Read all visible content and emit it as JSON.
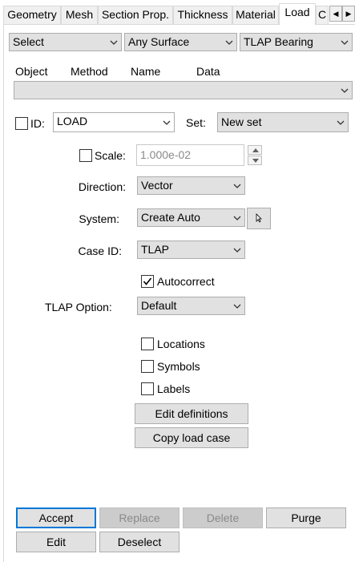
{
  "tabs": [
    {
      "label": "Geometry",
      "active": false
    },
    {
      "label": "Mesh",
      "active": false
    },
    {
      "label": "Section Prop.",
      "active": false
    },
    {
      "label": "Thickness",
      "active": false
    },
    {
      "label": "Material",
      "active": false
    },
    {
      "label": "Load",
      "active": true
    },
    {
      "label": "C",
      "active": false
    }
  ],
  "tab_scroll": {
    "left": "◀",
    "right": "▶"
  },
  "top_selectors": {
    "action": "Select",
    "scope": "Any Surface",
    "load_type": "TLAP Bearing"
  },
  "columns": {
    "object": "Object",
    "method": "Method",
    "name": "Name",
    "data": "Data"
  },
  "id_row": {
    "id_label": "ID:",
    "id_checked": false,
    "id_value": "LOAD",
    "set_label": "Set:",
    "set_value": "New set"
  },
  "scale": {
    "label": "Scale:",
    "checked": false,
    "value": "1.000e-02"
  },
  "direction": {
    "label": "Direction:",
    "value": "Vector"
  },
  "system": {
    "label": "System:",
    "value": "Create Auto"
  },
  "case_id": {
    "label": "Case ID:",
    "value": "TLAP"
  },
  "autocorrect": {
    "label": "Autocorrect",
    "checked": true
  },
  "tlap_option": {
    "label": "TLAP Option:",
    "value": "Default"
  },
  "display_options": {
    "locations": {
      "label": "Locations",
      "checked": false
    },
    "symbols": {
      "label": "Symbols",
      "checked": false
    },
    "labels": {
      "label": "Labels",
      "checked": false
    }
  },
  "buttons": {
    "edit_definitions": "Edit definitions",
    "copy_load_case": "Copy load case",
    "accept": "Accept",
    "replace": "Replace",
    "delete": "Delete",
    "purge": "Purge",
    "edit": "Edit",
    "deselect": "Deselect"
  },
  "colors": {
    "accent": "#0078d7",
    "button_bg": "#e1e1e1",
    "disabled_bg": "#cccccc",
    "disabled_text": "#8a8a8a"
  }
}
